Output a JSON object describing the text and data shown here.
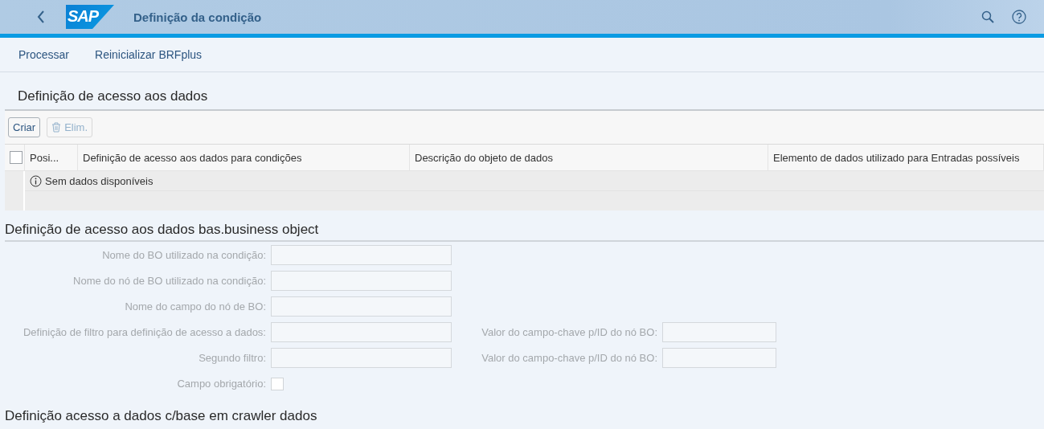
{
  "header": {
    "logo": "SAP",
    "title": "Definição da condição"
  },
  "toolbar": [
    "Processar",
    "Reinicializar BRFplus"
  ],
  "access_section": {
    "title": "Definição de acesso aos dados",
    "buttons": [
      {
        "label": "Criar",
        "disabled": false,
        "kind": "text"
      },
      {
        "label": "Elim.",
        "disabled": true,
        "kind": "delete"
      }
    ],
    "table": {
      "select_all_checked": false,
      "columns": [
        "Posi...",
        "Definição de acesso aos dados para condições",
        "Descrição do objeto de dados",
        "Elemento de dados utilizado para Entradas possíveis"
      ],
      "empty_text": "Sem dados disponíveis"
    }
  },
  "bo_section": {
    "title": "Definição de acesso aos dados bas.business object",
    "disabled": true,
    "rows": [
      {
        "kind": "input",
        "label": "Nome do BO utilizado na condição:"
      },
      {
        "kind": "input",
        "label": "Nome do nó de BO utilizado na condição:"
      },
      {
        "kind": "input",
        "label": "Nome do campo do nó de BO:"
      },
      {
        "kind": "input",
        "label": "Definição de filtro para definição de acesso a dados:",
        "side_label": "Valor do campo-chave p/ID do nó BO:"
      },
      {
        "kind": "input",
        "label": "Segundo filtro:",
        "side_label": "Valor do campo-chave p/ID do nó BO:"
      },
      {
        "kind": "checkbox",
        "label": "Campo obrigatório:",
        "checked": false
      }
    ]
  },
  "crawler_section": {
    "title": "Definição acesso a dados c/base em crawler dados"
  }
}
